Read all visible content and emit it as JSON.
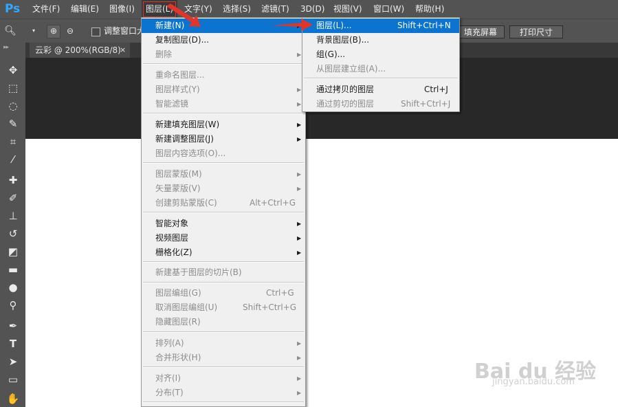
{
  "app": {
    "logo": "Ps"
  },
  "menubar": {
    "items": [
      {
        "label": "文件(F)"
      },
      {
        "label": "编辑(E)"
      },
      {
        "label": "图像(I)"
      },
      {
        "label": "图层(L)"
      },
      {
        "label": "文字(Y)"
      },
      {
        "label": "选择(S)"
      },
      {
        "label": "滤镜(T)"
      },
      {
        "label": "3D(D)"
      },
      {
        "label": "视图(V)"
      },
      {
        "label": "窗口(W)"
      },
      {
        "label": "帮助(H)"
      }
    ],
    "active": "图层(L)"
  },
  "options_bar": {
    "resize_window_label": "调整窗口大",
    "fill_screen_label": "填充屏幕",
    "print_size_label": "打印尺寸"
  },
  "document": {
    "tab_title": "云彩 @ 200%(RGB/8)",
    "tab_close": "×"
  },
  "layer_menu": {
    "items": [
      {
        "label": "新建(N)",
        "shortcut": "",
        "submenu": true,
        "enabled": true,
        "highlighted": true
      },
      {
        "label": "复制图层(D)...",
        "shortcut": "",
        "submenu": false,
        "enabled": true
      },
      {
        "label": "删除",
        "shortcut": "",
        "submenu": true,
        "enabled": false
      },
      {
        "label": "重命名图层...",
        "shortcut": "",
        "submenu": false,
        "enabled": false
      },
      {
        "label": "图层样式(Y)",
        "shortcut": "",
        "submenu": true,
        "enabled": false
      },
      {
        "label": "智能滤镜",
        "shortcut": "",
        "submenu": true,
        "enabled": false
      },
      {
        "label": "新建填充图层(W)",
        "shortcut": "",
        "submenu": true,
        "enabled": true
      },
      {
        "label": "新建调整图层(J)",
        "shortcut": "",
        "submenu": true,
        "enabled": true
      },
      {
        "label": "图层内容选项(O)...",
        "shortcut": "",
        "submenu": false,
        "enabled": false
      },
      {
        "label": "图层蒙版(M)",
        "shortcut": "",
        "submenu": true,
        "enabled": false
      },
      {
        "label": "矢量蒙版(V)",
        "shortcut": "",
        "submenu": true,
        "enabled": false
      },
      {
        "label": "创建剪贴蒙版(C)",
        "shortcut": "Alt+Ctrl+G",
        "submenu": false,
        "enabled": false
      },
      {
        "label": "智能对象",
        "shortcut": "",
        "submenu": true,
        "enabled": true
      },
      {
        "label": "视频图层",
        "shortcut": "",
        "submenu": true,
        "enabled": true
      },
      {
        "label": "栅格化(Z)",
        "shortcut": "",
        "submenu": true,
        "enabled": true
      },
      {
        "label": "新建基于图层的切片(B)",
        "shortcut": "",
        "submenu": false,
        "enabled": false
      },
      {
        "label": "图层编组(G)",
        "shortcut": "Ctrl+G",
        "submenu": false,
        "enabled": false
      },
      {
        "label": "取消图层编组(U)",
        "shortcut": "Shift+Ctrl+G",
        "submenu": false,
        "enabled": false
      },
      {
        "label": "隐藏图层(R)",
        "shortcut": "",
        "submenu": false,
        "enabled": false
      },
      {
        "label": "排列(A)",
        "shortcut": "",
        "submenu": true,
        "enabled": false
      },
      {
        "label": "合并形状(H)",
        "shortcut": "",
        "submenu": true,
        "enabled": false
      },
      {
        "label": "对齐(I)",
        "shortcut": "",
        "submenu": true,
        "enabled": false
      },
      {
        "label": "分布(T)",
        "shortcut": "",
        "submenu": true,
        "enabled": false
      }
    ]
  },
  "new_submenu": {
    "items": [
      {
        "label": "图层(L)...",
        "shortcut": "Shift+Ctrl+N",
        "enabled": true,
        "highlighted": true
      },
      {
        "label": "背景图层(B)...",
        "shortcut": "",
        "enabled": true
      },
      {
        "label": "组(G)...",
        "shortcut": "",
        "enabled": true
      },
      {
        "label": "从图层建立组(A)...",
        "shortcut": "",
        "enabled": false
      },
      {
        "label": "通过拷贝的图层",
        "shortcut": "Ctrl+J",
        "enabled": true
      },
      {
        "label": "通过剪切的图层",
        "shortcut": "Shift+Ctrl+J",
        "enabled": false
      }
    ]
  },
  "watermark": {
    "text": "Bai du 经验",
    "sub": "jingyan.baidu.com"
  },
  "colors": {
    "highlight": "#0a74d0",
    "annotation": "#e0352b",
    "ps_blue": "#31a8ff"
  }
}
